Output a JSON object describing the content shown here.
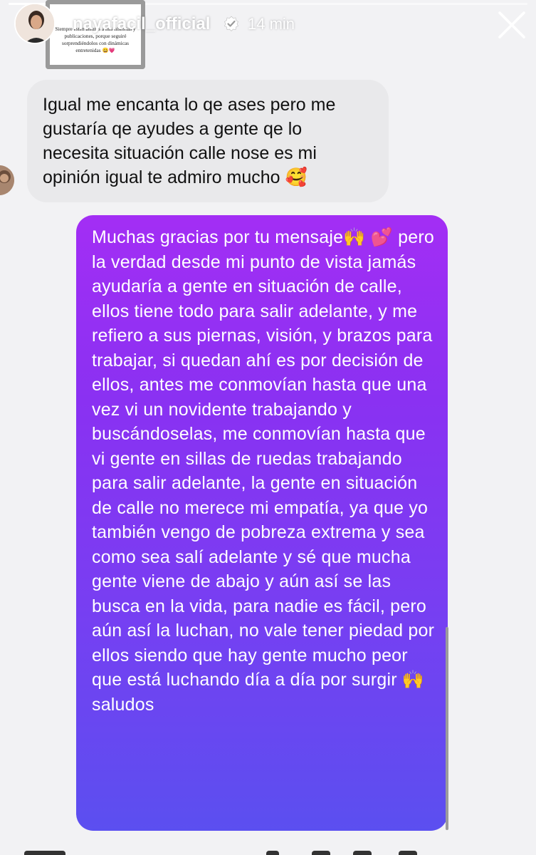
{
  "story": {
    "progress": 0.15
  },
  "header": {
    "username": "nayafacil_official",
    "time": "14 min",
    "verified": true
  },
  "story_thumbnail": {
    "text": "Siempre estén atentos a mis historias y publicaciones, porque seguiré sorprendiéndolos con dinámicas entretenidas 😀💗"
  },
  "messages": {
    "received": {
      "text": "Igual me encanta lo qe ases pero me gustaría qe ayudes a gente qe lo necesita situación calle nose es mi opinión igual te admiro mucho 🥰"
    },
    "sent": {
      "text": "Muchas gracias por tu mensaje🙌 💕 pero la verdad desde mi punto de vista jamás ayudaría a gente en situación de calle, ellos tiene todo para salir adelante, y me refiero a sus piernas, visión, y brazos para trabajar, si quedan ahí es por decisión de ellos, antes me conmovían hasta que una vez vi un novidente trabajando y buscándoselas, me conmovían hasta que vi gente en sillas de ruedas trabajando para salir adelante, la gente en situación de calle no merece mi empatía, ya que yo también vengo de pobreza extrema y sea como sea salí adelante y sé que mucha gente viene de abajo y aún así se las busca en la vida, para nadie es fácil, pero aún así la luchan, no vale tener piedad por ellos siendo que hay gente mucho peor que está luchando día a día por surgir 🙌 saludos"
    }
  },
  "colors": {
    "background": "#f2f2f4",
    "received_bubble": "#e9e9eb",
    "sent_bubble_top": "#a32ef4",
    "sent_bubble_bottom": "#5b4ff0",
    "verified_badge": "#ffffff"
  },
  "icons": {
    "close": "close-icon",
    "verified": "verified-badge-icon"
  }
}
